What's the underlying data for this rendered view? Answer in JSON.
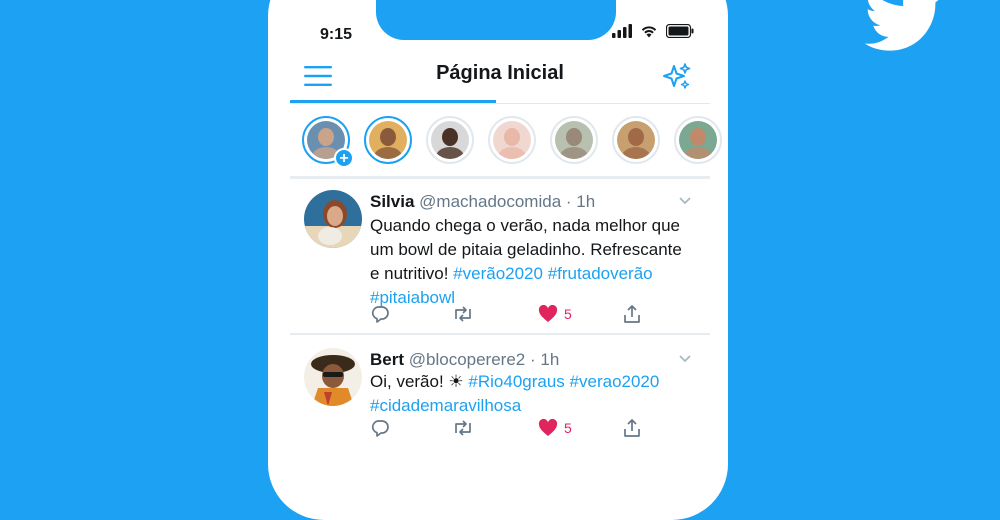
{
  "status_bar": {
    "time": "9:15"
  },
  "header": {
    "title": "Página Inicial"
  },
  "fleets": [
    {
      "name": "your-fleet",
      "unseen": true,
      "has_add": true,
      "skin": "#c9a48a",
      "bg": "#6b8fb0"
    },
    {
      "name": "fleet-2",
      "unseen": true,
      "has_add": false,
      "skin": "#8a5a3c",
      "bg": "#e0b060"
    },
    {
      "name": "fleet-3",
      "unseen": false,
      "has_add": false,
      "skin": "#4a3326",
      "bg": "#d8d8d8"
    },
    {
      "name": "fleet-4",
      "unseen": false,
      "has_add": false,
      "skin": "#e8b8a8",
      "bg": "#f0d8d0"
    },
    {
      "name": "fleet-5",
      "unseen": false,
      "has_add": false,
      "skin": "#9a8878",
      "bg": "#b8c0b0"
    },
    {
      "name": "fleet-6",
      "unseen": false,
      "has_add": false,
      "skin": "#a06a48",
      "bg": "#c8a070"
    },
    {
      "name": "fleet-7",
      "unseen": false,
      "has_add": false,
      "skin": "#c08a6a",
      "bg": "#7aa890"
    }
  ],
  "tweets": [
    {
      "name": "Silvia",
      "handle": "@machadocomida",
      "time": "· 1h",
      "text": "Quando chega o verão, nada melhor que um bowl de pitaia geladinho. Refrescante e nutritivo!",
      "tags": [
        "#verão2020",
        "#frutadoverão",
        "#pitaiabowl"
      ],
      "likes": "5"
    },
    {
      "name": "Bert",
      "handle": "@blocoperere2",
      "time": "· 1h",
      "text": "Oi, verão! ☀",
      "tags": [
        "#Rio40graus",
        "#verao2020",
        "#cidademaravilhosa"
      ],
      "likes": "5"
    }
  ],
  "colors": {
    "brand": "#1DA1F2",
    "like": "#E0245E",
    "text": "#14171A",
    "muted": "#657786"
  }
}
